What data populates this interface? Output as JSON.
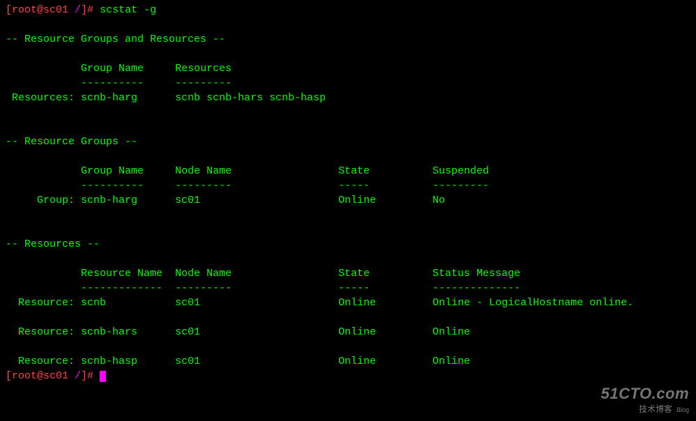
{
  "prompt": {
    "user_host": "[root@sc01 ",
    "path": "/",
    "end": "]# ",
    "command": "scstat -g"
  },
  "section1": {
    "header": "-- Resource Groups and Resources --",
    "col1_header": "Group Name",
    "col2_header": "Resources",
    "col1_underline": "----------",
    "col2_underline": "---------",
    "row_label": " Resources:",
    "row_col1": "scnb-harg",
    "row_col2": "scnb scnb-hars scnb-hasp"
  },
  "section2": {
    "header": "-- Resource Groups --",
    "col1_header": "Group Name",
    "col2_header": "Node Name",
    "col3_header": "State",
    "col4_header": "Suspended",
    "col1_underline": "----------",
    "col2_underline": "---------",
    "col3_underline": "-----",
    "col4_underline": "---------",
    "row_label": "     Group:",
    "row_col1": "scnb-harg",
    "row_col2": "sc01",
    "row_col3": "Online",
    "row_col4": "No"
  },
  "section3": {
    "header": "-- Resources --",
    "col1_header": "Resource Name",
    "col2_header": "Node Name",
    "col3_header": "State",
    "col4_header": "Status Message",
    "col1_underline": "-------------",
    "col2_underline": "---------",
    "col3_underline": "-----",
    "col4_underline": "--------------",
    "rows": [
      {
        "label": "  Resource:",
        "col1": "scnb",
        "col2": "sc01",
        "col3": "Online",
        "col4": "Online - LogicalHostname online."
      },
      {
        "label": "  Resource:",
        "col1": "scnb-hars",
        "col2": "sc01",
        "col3": "Online",
        "col4": "Online"
      },
      {
        "label": "  Resource:",
        "col1": "scnb-hasp",
        "col2": "sc01",
        "col3": "Online",
        "col4": "Online"
      }
    ]
  },
  "watermark": {
    "line1": "51CTO.com",
    "line2": "技术博客",
    "blog": "Blog"
  },
  "chart_data": {
    "type": "table",
    "title": "scstat -g output",
    "tables": [
      {
        "name": "Resource Groups and Resources",
        "columns": [
          "Group Name",
          "Resources"
        ],
        "rows": [
          [
            "scnb-harg",
            "scnb scnb-hars scnb-hasp"
          ]
        ]
      },
      {
        "name": "Resource Groups",
        "columns": [
          "Group Name",
          "Node Name",
          "State",
          "Suspended"
        ],
        "rows": [
          [
            "scnb-harg",
            "sc01",
            "Online",
            "No"
          ]
        ]
      },
      {
        "name": "Resources",
        "columns": [
          "Resource Name",
          "Node Name",
          "State",
          "Status Message"
        ],
        "rows": [
          [
            "scnb",
            "sc01",
            "Online",
            "Online - LogicalHostname online."
          ],
          [
            "scnb-hars",
            "sc01",
            "Online",
            "Online"
          ],
          [
            "scnb-hasp",
            "sc01",
            "Online",
            "Online"
          ]
        ]
      }
    ]
  }
}
